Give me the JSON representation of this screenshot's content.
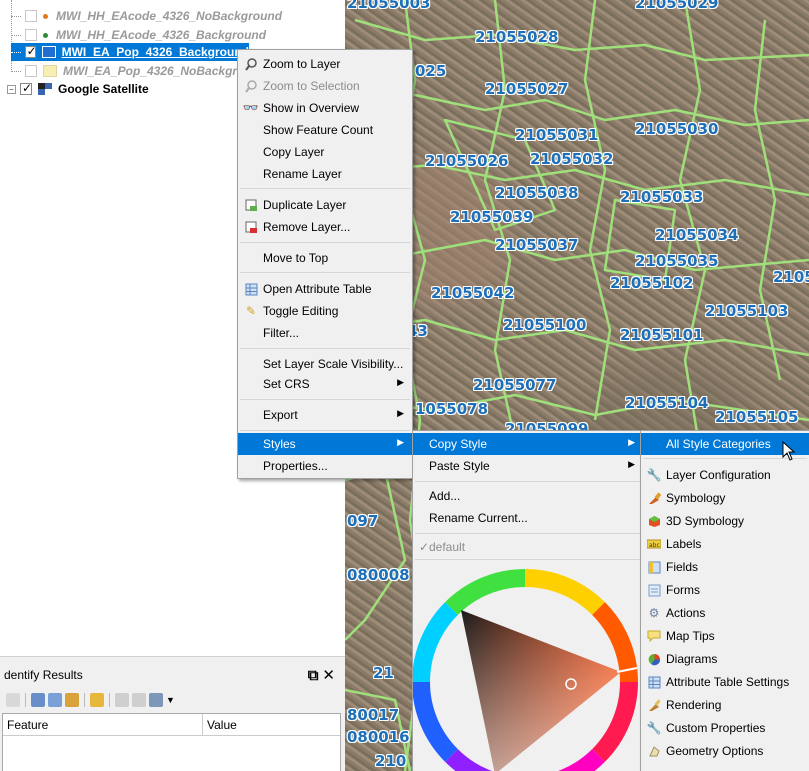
{
  "layers": [
    {
      "name": "MWI_HH_EAcode_4326_NoBackground",
      "style": "grey",
      "checked": false,
      "symbol": "dot",
      "color": "#e07a1a"
    },
    {
      "name": "MWI_HH_EAcode_4326_Background",
      "style": "grey",
      "checked": false,
      "symbol": "dot",
      "color": "#2e8b3a"
    },
    {
      "name": "MWI_EA_Pop_4326_Background",
      "style": "selected",
      "checked": true,
      "symbol": "swatch",
      "color": "#1f6fd0"
    },
    {
      "name": "MWI_EA_Pop_4326_NoBackground",
      "style": "grey",
      "checked": false,
      "symbol": "swatch",
      "color": "#f7eeb4"
    },
    {
      "name": "Google Satellite",
      "style": "bold",
      "checked": true,
      "symbol": "raster",
      "color": "#3a66b0"
    }
  ],
  "identify": {
    "title": "dentify Results",
    "columns": [
      "Feature",
      "Value"
    ]
  },
  "context_menu": {
    "items": [
      {
        "label": "Zoom to Layer",
        "icon": "zoom-icon",
        "enabled": true
      },
      {
        "label": "Zoom to Selection",
        "icon": "zoom-selection-icon",
        "enabled": false
      },
      {
        "label": "Show in Overview",
        "icon": "overview-icon",
        "enabled": true
      },
      {
        "label": "Show Feature Count",
        "icon": "",
        "enabled": true
      },
      {
        "label": "Copy Layer",
        "icon": "",
        "enabled": true
      },
      {
        "label": "Rename Layer",
        "icon": "",
        "enabled": true
      },
      {
        "label": "Duplicate Layer",
        "icon": "duplicate-icon",
        "enabled": true
      },
      {
        "label": "Remove Layer...",
        "icon": "remove-icon",
        "enabled": true
      },
      {
        "label": "Move to Top",
        "icon": "",
        "enabled": true
      },
      {
        "label": "Open Attribute Table",
        "icon": "table-icon",
        "enabled": true
      },
      {
        "label": "Toggle Editing",
        "icon": "pencil-icon",
        "enabled": true
      },
      {
        "label": "Filter...",
        "icon": "",
        "enabled": true
      },
      {
        "label": "Set Layer Scale Visibility...",
        "icon": "",
        "enabled": true
      },
      {
        "label": "Set CRS",
        "icon": "",
        "enabled": true,
        "submenu": true
      },
      {
        "label": "Export",
        "icon": "",
        "enabled": true,
        "submenu": true
      },
      {
        "label": "Styles",
        "icon": "",
        "enabled": true,
        "submenu": true,
        "active": true
      },
      {
        "label": "Properties...",
        "icon": "",
        "enabled": true
      }
    ]
  },
  "styles_menu": {
    "items": [
      {
        "label": "Copy Style",
        "submenu": true,
        "active": true
      },
      {
        "label": "Paste Style",
        "submenu": true
      },
      {
        "label": "Add..."
      },
      {
        "label": "Rename Current..."
      },
      {
        "label": "default",
        "checked": true
      }
    ]
  },
  "copy_style_menu": {
    "items": [
      {
        "label": "All Style Categories",
        "icon": "",
        "active": true
      },
      {
        "label": "Layer Configuration",
        "icon": "layer-config-icon"
      },
      {
        "label": "Symbology",
        "icon": "symbology-icon"
      },
      {
        "label": "3D Symbology",
        "icon": "3d-symbology-icon"
      },
      {
        "label": "Labels",
        "icon": "labels-icon"
      },
      {
        "label": "Fields",
        "icon": "fields-icon"
      },
      {
        "label": "Forms",
        "icon": "forms-icon"
      },
      {
        "label": "Actions",
        "icon": "actions-icon"
      },
      {
        "label": "Map Tips",
        "icon": "map-tips-icon"
      },
      {
        "label": "Diagrams",
        "icon": "diagrams-icon"
      },
      {
        "label": "Attribute Table Settings",
        "icon": "attribute-table-icon"
      },
      {
        "label": "Rendering",
        "icon": "rendering-icon"
      },
      {
        "label": "Custom Properties",
        "icon": "custom-properties-icon"
      },
      {
        "label": "Geometry Options",
        "icon": "geometry-options-icon"
      }
    ]
  },
  "map_labels": [
    "21055003",
    "21055029",
    "21055028",
    "025",
    "21055027",
    "21055031",
    "21055030",
    "21055026",
    "21055032",
    "21055038",
    "21055033",
    "21055039",
    "21055034",
    "21055037",
    "21055035",
    "21055102",
    "2105",
    "21055042",
    "21055103",
    "21055100",
    "21055101",
    "43",
    "21055077",
    "1055078",
    "21055104",
    "21055105",
    "21055099",
    "097",
    "080008",
    "21",
    "80017",
    "080016",
    "210"
  ]
}
